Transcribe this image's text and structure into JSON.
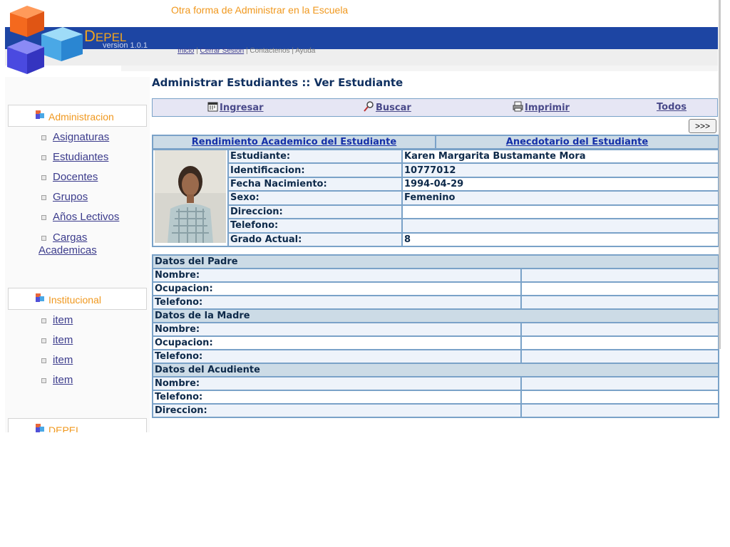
{
  "header": {
    "tagline": "Otra forma de Administrar en la Escuela",
    "brand_d": "D",
    "brand_rest": "EPEL",
    "version": "version 1.0.1",
    "nav": {
      "inicio": "Inicio",
      "sep1": "|",
      "cerrar": "Cerrar Sesion",
      "sep2": "|",
      "contactenos": "Contactenos",
      "sep3": "|",
      "ayuda": "Ayuda"
    }
  },
  "sidebar": {
    "admin_title": "Administracion",
    "admin_items": [
      "Asignaturas",
      "Estudiantes",
      "Docentes",
      "Grupos",
      "Años Lectivos",
      "Cargas Academicas"
    ],
    "inst_title": "Institucional",
    "inst_items": [
      "item",
      "item",
      "item",
      "item"
    ],
    "depel_title": "DEPEL"
  },
  "main": {
    "title": "Administrar Estudiantes :: Ver Estudiante",
    "toolbar": {
      "ingresar": "Ingresar",
      "buscar": "Buscar",
      "imprimir": "Imprimir",
      "todos": "Todos"
    },
    "next_button": ">>>",
    "tabs": {
      "rendimiento": "Rendimiento Academico del Estudiante",
      "anecdotario": "Anecdotario del Estudiante"
    },
    "student": {
      "rows": [
        {
          "label": "Estudiante:",
          "value": "Karen Margarita Bustamante Mora"
        },
        {
          "label": "Identificacion:",
          "value": "10777012"
        },
        {
          "label": "Fecha Nacimiento:",
          "value": "1994-04-29"
        },
        {
          "label": "Sexo:",
          "value": "Femenino"
        },
        {
          "label": "Direccion:",
          "value": ""
        },
        {
          "label": "Telefono:",
          "value": ""
        },
        {
          "label": "Grado Actual:",
          "value": "8"
        }
      ]
    },
    "padre": {
      "title": "Datos del Padre",
      "rows": [
        "Nombre:",
        "Ocupacion:",
        "Telefono:"
      ]
    },
    "madre": {
      "title": "Datos de la Madre",
      "rows": [
        "Nombre:",
        "Ocupacion:",
        "Telefono:"
      ]
    },
    "acudiente": {
      "title": "Datos del Acudiente",
      "rows": [
        "Nombre:",
        "Telefono:",
        "Direccion:"
      ]
    }
  },
  "colors": {
    "accent_orange": "#f0981e",
    "header_blue": "#1d45a3",
    "grid_border": "#7aa2c8",
    "section_bg": "#ccdbe6"
  }
}
